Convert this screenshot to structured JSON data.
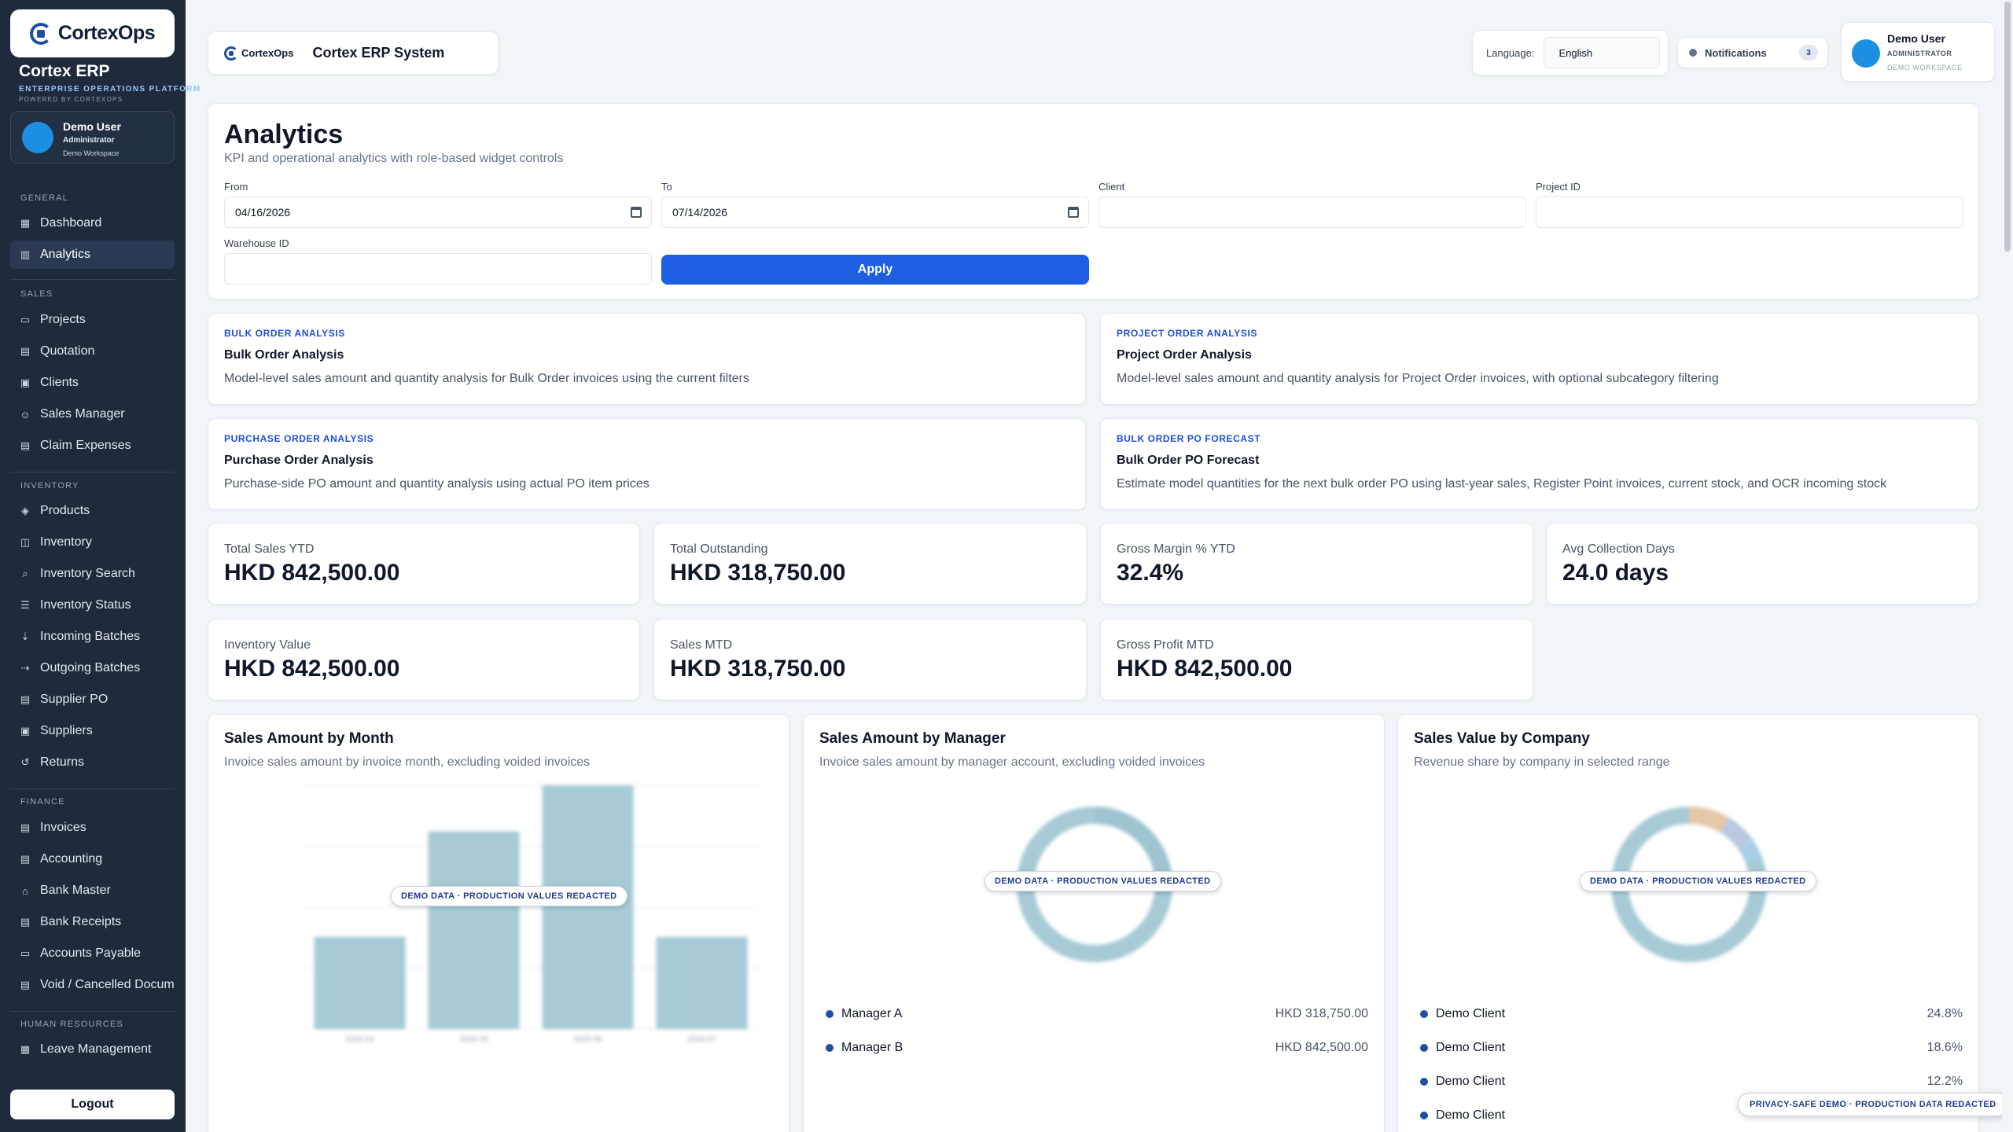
{
  "brand": {
    "logo_text": "CortexOps",
    "title": "Cortex ERP",
    "subtitle": "ENTERPRISE OPERATIONS PLATFORM",
    "powered": "POWERED BY CORTEXOPS"
  },
  "sidebar_user": {
    "name": "Demo User",
    "role": "Administrator",
    "workspace": "Demo Workspace"
  },
  "sections": [
    {
      "label": "GENERAL",
      "items": [
        {
          "label": "Dashboard",
          "icon": "grid-icon"
        },
        {
          "label": "Analytics",
          "icon": "bar-chart-icon",
          "active": true
        }
      ]
    },
    {
      "label": "SALES",
      "items": [
        {
          "label": "Projects",
          "icon": "folder-icon"
        },
        {
          "label": "Quotation",
          "icon": "document-icon"
        },
        {
          "label": "Clients",
          "icon": "building-icon"
        },
        {
          "label": "Sales Manager",
          "icon": "user-check-icon"
        },
        {
          "label": "Claim Expenses",
          "icon": "receipt-icon"
        }
      ]
    },
    {
      "label": "INVENTORY",
      "items": [
        {
          "label": "Products",
          "icon": "tag-icon"
        },
        {
          "label": "Inventory",
          "icon": "box-icon"
        },
        {
          "label": "Inventory Search",
          "icon": "search-icon"
        },
        {
          "label": "Inventory Status",
          "icon": "list-icon"
        },
        {
          "label": "Incoming Batches",
          "icon": "inbox-icon"
        },
        {
          "label": "Outgoing Batches",
          "icon": "truck-icon"
        },
        {
          "label": "Supplier PO",
          "icon": "clipboard-icon"
        },
        {
          "label": "Suppliers",
          "icon": "factory-icon"
        },
        {
          "label": "Returns",
          "icon": "return-icon"
        }
      ]
    },
    {
      "label": "FINANCE",
      "items": [
        {
          "label": "Invoices",
          "icon": "invoice-icon"
        },
        {
          "label": "Accounting",
          "icon": "ledger-icon"
        },
        {
          "label": "Bank Master",
          "icon": "bank-icon"
        },
        {
          "label": "Bank Receipts",
          "icon": "receipt-icon"
        },
        {
          "label": "Accounts Payable",
          "icon": "wallet-icon"
        },
        {
          "label": "Void / Cancelled Docum",
          "icon": "void-document-icon"
        }
      ]
    },
    {
      "label": "HUMAN RESOURCES",
      "items": [
        {
          "label": "Leave Management",
          "icon": "calendar-icon"
        }
      ]
    }
  ],
  "logout_label": "Logout",
  "topbar": {
    "logo_text": "CortexOps",
    "title": "Cortex ERP System",
    "language_label": "Language:",
    "language_value": "English",
    "notifications_label": "Notifications",
    "notifications_count": "3",
    "user_name": "Demo User",
    "user_role": "ADMINISTRATOR",
    "user_workspace": "DEMO WORKSPACE"
  },
  "filters": {
    "title": "Analytics",
    "subtitle": "KPI and operational analytics with role-based widget controls",
    "from_label": "From",
    "from_value": "04/16/2026",
    "to_label": "To",
    "to_value": "07/14/2026",
    "client_label": "Client",
    "client_value": "",
    "project_label": "Project ID",
    "project_value": "",
    "warehouse_label": "Warehouse ID",
    "warehouse_value": "",
    "apply_label": "Apply"
  },
  "reports": [
    {
      "kicker": "BULK ORDER ANALYSIS",
      "title": "Bulk Order Analysis",
      "desc": "Model-level sales amount and quantity analysis for Bulk Order invoices using the current filters"
    },
    {
      "kicker": "PROJECT ORDER ANALYSIS",
      "title": "Project Order Analysis",
      "desc": "Model-level sales amount and quantity analysis for Project Order invoices, with optional subcategory filtering"
    },
    {
      "kicker": "PURCHASE ORDER ANALYSIS",
      "title": "Purchase Order Analysis",
      "desc": "Purchase-side PO amount and quantity analysis using actual PO item prices"
    },
    {
      "kicker": "BULK ORDER PO FORECAST",
      "title": "Bulk Order PO Forecast",
      "desc": "Estimate model quantities for the next bulk order PO using last-year sales, Register Point invoices, current stock, and OCR incoming stock"
    }
  ],
  "kpis": [
    {
      "label": "Total Sales YTD",
      "value": "HKD 842,500.00"
    },
    {
      "label": "Total Outstanding",
      "value": "HKD 318,750.00"
    },
    {
      "label": "Gross Margin % YTD",
      "value": "32.4%"
    },
    {
      "label": "Avg Collection Days",
      "value": "24.0 days"
    },
    {
      "label": "Inventory Value",
      "value": "HKD 842,500.00"
    },
    {
      "label": "Sales MTD",
      "value": "HKD 318,750.00"
    },
    {
      "label": "Gross Profit MTD",
      "value": "HKD 842,500.00"
    }
  ],
  "charts": {
    "month": {
      "title": "Sales Amount by Month",
      "subtitle": "Invoice sales amount by invoice month, excluding voided invoices",
      "redact_label": "DEMO DATA · PRODUCTION VALUES REDACTED"
    },
    "manager": {
      "title": "Sales Amount by Manager",
      "subtitle": "Invoice sales amount by manager account, excluding voided invoices",
      "redact_label": "DEMO DATA · PRODUCTION VALUES REDACTED",
      "legend": [
        {
          "name": "Manager A",
          "value": "HKD 318,750.00"
        },
        {
          "name": "Manager B",
          "value": "HKD 842,500.00"
        }
      ]
    },
    "company": {
      "title": "Sales Value by Company",
      "subtitle": "Revenue share by company in selected range",
      "redact_label": "DEMO DATA · PRODUCTION VALUES REDACTED",
      "legend": [
        {
          "name": "Demo Client",
          "value": "24.8%"
        },
        {
          "name": "Demo Client",
          "value": "18.6%"
        },
        {
          "name": "Demo Client",
          "value": "12.2%"
        },
        {
          "name": "Demo Client",
          "value": ""
        }
      ]
    }
  },
  "chart_data": [
    {
      "type": "bar",
      "categories": [
        "2026-04",
        "2026-05",
        "2026-06",
        "2026-07"
      ],
      "values": [
        318750,
        683000,
        842500,
        318750
      ],
      "title": "Sales Amount by Month",
      "ylim": [
        0,
        842500
      ]
    },
    {
      "type": "pie",
      "title": "Sales Amount by Manager",
      "series": [
        {
          "name": "Manager A",
          "value": 318750
        },
        {
          "name": "Manager B",
          "value": 842500
        }
      ]
    },
    {
      "type": "pie",
      "title": "Sales Value by Company",
      "series": [
        {
          "name": "Demo Client",
          "value": 24.8
        },
        {
          "name": "Demo Client",
          "value": 18.6
        },
        {
          "name": "Demo Client",
          "value": 12.2
        }
      ]
    }
  ],
  "privacy_label": "PRIVACY-SAFE DEMO · PRODUCTION DATA REDACTED",
  "colors": {
    "sidebar": "#1f2a3c",
    "accent": "#1d5fe0",
    "bar": "#a7cbd6",
    "donut": "#a7cbd6"
  }
}
